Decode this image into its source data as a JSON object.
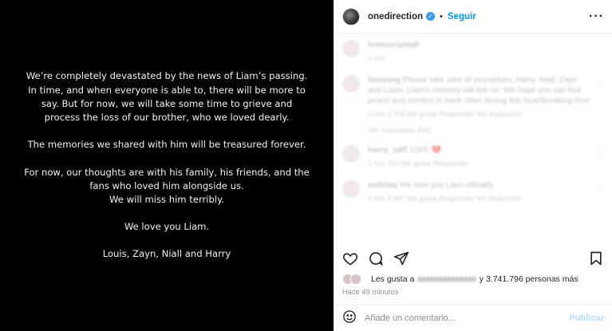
{
  "post": {
    "paragraphs": [
      [
        "We’re completely devastated by the news of Liam’s passing.",
        "In time, and when everyone is able to, there will be more to",
        "say. But for now, we will take some time to grieve and",
        "process the loss of our brother, who we loved dearly."
      ],
      [
        "The memories we shared with him will be treasured forever."
      ],
      [
        "For now, our thoughts are with his family, his friends, and the",
        "fans who loved him alongside us.",
        "We will miss him terribly."
      ],
      [
        "We love you Liam."
      ],
      [
        "Louis, Zayn, Niall and Harry"
      ]
    ]
  },
  "header": {
    "username": "onedirection",
    "separator": "•",
    "follow_label": "Seguir",
    "more_icon": "more-icon"
  },
  "comments": [
    {
      "name": "lovecurlyniall",
      "text": "",
      "meta": "1 min",
      "heart": "♡"
    },
    {
      "name": "louisang",
      "text": "Please take care of yourselves, Harry, Niall, Zayn and Louis. Liam's memory will live on. We hope you can find peace and comfort in each other during this heartbreaking time",
      "meta": "2 min  1.205 Me gusta  Responder  Ver traducción",
      "heart": "♡"
    },
    {
      "name": "",
      "text": "",
      "meta": "Ver respuestas (56)",
      "heart": ""
    },
    {
      "name": "harry_1dff",
      "text": "1DFF 💔",
      "meta": "1 min  103 Me gusta  Responder",
      "heart": "♡"
    },
    {
      "name": "xoliviaq",
      "text": "We love you Liam officially",
      "meta": "2 min  2.657 Me gusta  Responder  Ver traducción",
      "heart": "♡"
    }
  ],
  "likes": {
    "prefix": "Les gusta a",
    "user": "xxxxxxxxxxxxxx",
    "suffix": "y 3.741.796 personas más"
  },
  "time_ago": "Hace 49 minutos",
  "comment_box": {
    "placeholder": "Añade un comentario...",
    "publish_label": "Publicar"
  }
}
